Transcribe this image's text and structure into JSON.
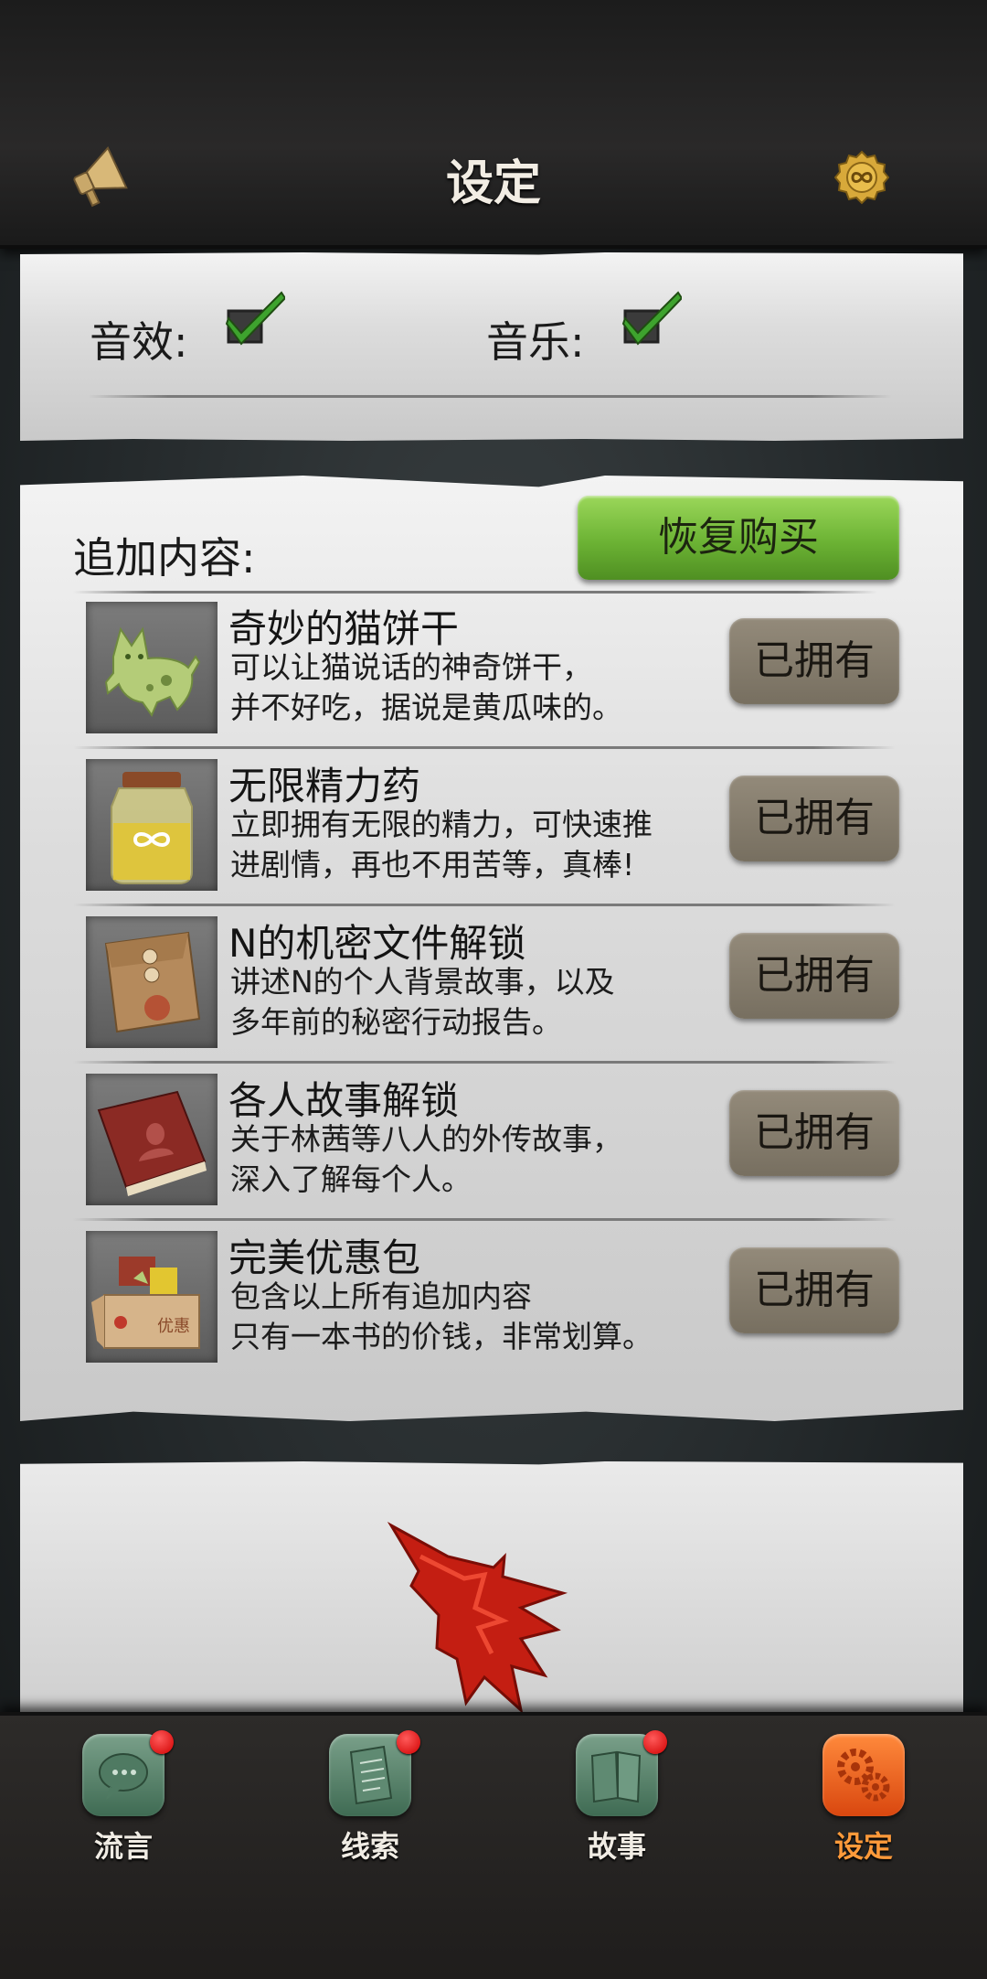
{
  "header": {
    "title": "设定",
    "left_icon": "megaphone-icon",
    "right_icon": "gold-coin-icon"
  },
  "sound_settings": {
    "sfx_label": "音效:",
    "sfx_checked": true,
    "music_label": "音乐:",
    "music_checked": true
  },
  "addons": {
    "title": "追加内容:",
    "restore_label": "恢复购买",
    "items": [
      {
        "title": "奇妙的猫饼干",
        "desc": "可以让猫说话的神奇饼干，\n并不好吃，据说是黄瓜味的。",
        "status": "已拥有",
        "icon": "cat-cookie-icon"
      },
      {
        "title": "无限精力药",
        "desc": "立即拥有无限的精力，可快速推\n进剧情，再也不用苦等，真棒!",
        "status": "已拥有",
        "icon": "potion-jar-icon"
      },
      {
        "title": "N的机密文件解锁",
        "desc": "讲述N的个人背景故事，以及\n多年前的秘密行动报告。",
        "status": "已拥有",
        "icon": "envelope-icon"
      },
      {
        "title": "各人故事解锁",
        "desc": "关于林茜等八人的外传故事，\n深入了解每个人。",
        "status": "已拥有",
        "icon": "book-icon"
      },
      {
        "title": "完美优惠包",
        "desc": "包含以上所有追加内容\n只有一本书的价钱，非常划算。",
        "status": "已拥有",
        "icon": "gift-box-icon",
        "box_text": "优惠"
      }
    ]
  },
  "nav": [
    {
      "label": "流言",
      "icon": "chat-icon",
      "badge": true,
      "active": false
    },
    {
      "label": "线索",
      "icon": "document-icon",
      "badge": true,
      "active": false
    },
    {
      "label": "故事",
      "icon": "book-open-icon",
      "badge": true,
      "active": false
    },
    {
      "label": "设定",
      "icon": "gears-icon",
      "badge": false,
      "active": true
    }
  ],
  "colors": {
    "accent_green": "#6cb334",
    "owned_button": "#857c6c",
    "active_tab": "#e85a18",
    "badge_red": "#d00000"
  }
}
